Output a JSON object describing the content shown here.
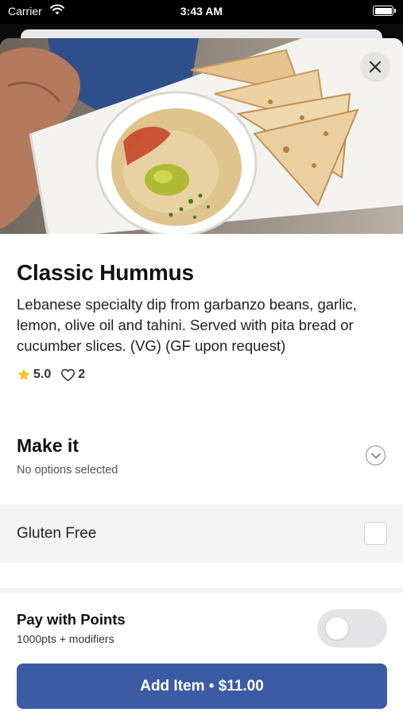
{
  "status_bar": {
    "carrier": "Carrier",
    "time": "3:43 AM"
  },
  "item": {
    "title": "Classic Hummus",
    "description": "Lebanese specialty dip from garbanzo beans, garlic, lemon, olive oil and tahini. Served with pita bread or cucumber slices. (VG) (GF upon request)",
    "rating": "5.0",
    "likes": "2",
    "image_alt": "Classic Hummus"
  },
  "make_it": {
    "title": "Make it",
    "subtitle": "No options selected",
    "options": [
      {
        "label": "Gluten Free",
        "checked": false
      }
    ]
  },
  "points": {
    "title": "Pay with Points",
    "subtitle": "1000pts + modifiers",
    "enabled": false
  },
  "cta": {
    "label": "Add Item • $11.00"
  },
  "colors": {
    "primary": "#3c5ba5",
    "star": "#f5c518",
    "toggle_off": "#e4e4e6"
  },
  "icons": {
    "wifi": "wifi-icon",
    "battery": "battery-icon",
    "close": "close-icon",
    "star": "star-icon",
    "heart": "heart-icon",
    "chevron": "chevron-down-icon"
  }
}
